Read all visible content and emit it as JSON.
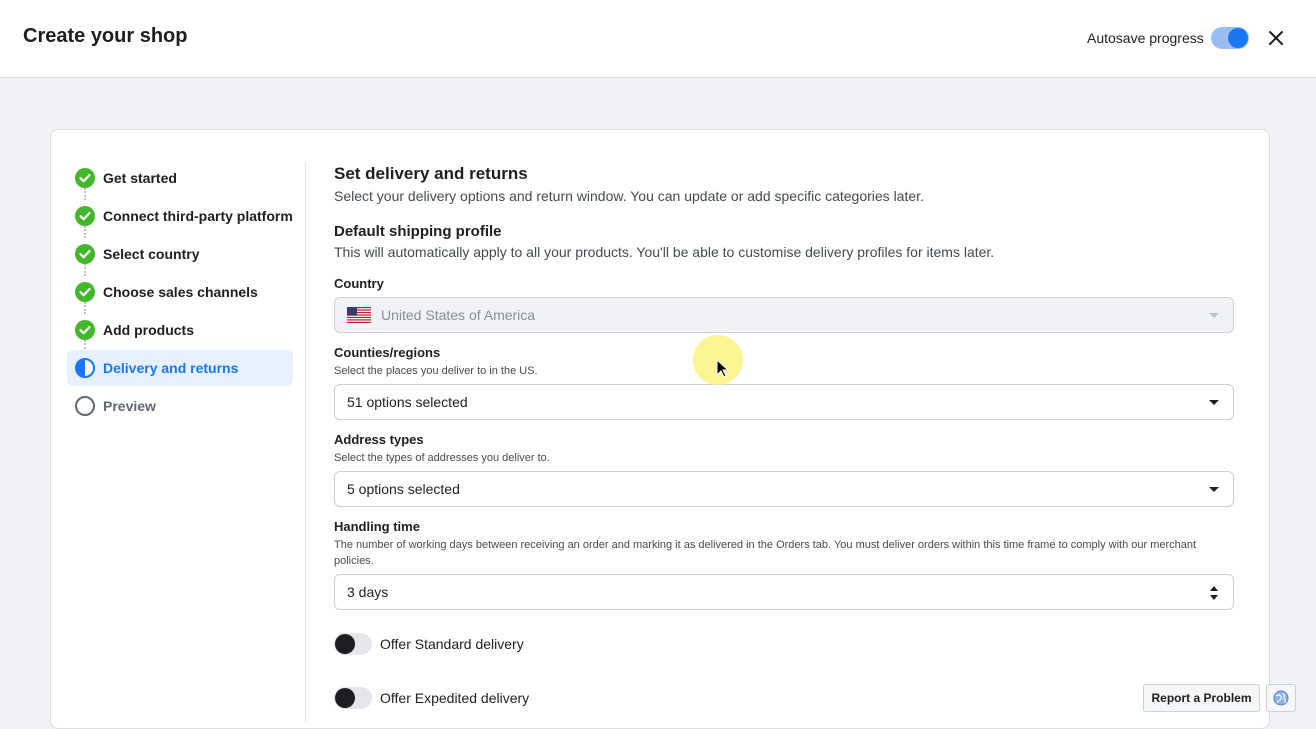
{
  "header": {
    "title": "Create your shop",
    "autosave_label": "Autosave progress",
    "autosave_on": true
  },
  "steps": [
    {
      "label": "Get started",
      "status": "complete"
    },
    {
      "label": "Connect third-party platform",
      "status": "complete"
    },
    {
      "label": "Select country",
      "status": "complete"
    },
    {
      "label": "Choose sales channels",
      "status": "complete"
    },
    {
      "label": "Add products",
      "status": "complete"
    },
    {
      "label": "Delivery and returns",
      "status": "in-progress"
    },
    {
      "label": "Preview",
      "status": "pending"
    }
  ],
  "main": {
    "title": "Set delivery and returns",
    "subtitle": "Select your delivery options and return window. You can update or add specific categories later.",
    "profile_title": "Default shipping profile",
    "profile_subtitle": "This will automatically apply to all your products. You'll be able to customise delivery profiles for items later.",
    "country": {
      "label": "Country",
      "value": "United States of America",
      "flag": "us-flag-icon"
    },
    "regions": {
      "label": "Counties/regions",
      "help": "Select the places you deliver to in the US.",
      "value": "51 options selected"
    },
    "address_types": {
      "label": "Address types",
      "help": "Select the types of addresses you deliver to.",
      "value": "5 options selected"
    },
    "handling_time": {
      "label": "Handling time",
      "help": "The number of working days between receiving an order and marking it as delivered in the Orders tab. You must deliver orders within this time frame to comply with our merchant policies.",
      "value": "3 days"
    },
    "standard_delivery": {
      "label": "Offer Standard delivery",
      "on": false
    },
    "expedited_delivery": {
      "label": "Offer Expedited delivery",
      "on": false
    }
  },
  "footer": {
    "report_label": "Report a Problem"
  },
  "colors": {
    "accent": "#1877f2",
    "complete": "#42b72a",
    "active_bg": "#e7f0fd"
  }
}
